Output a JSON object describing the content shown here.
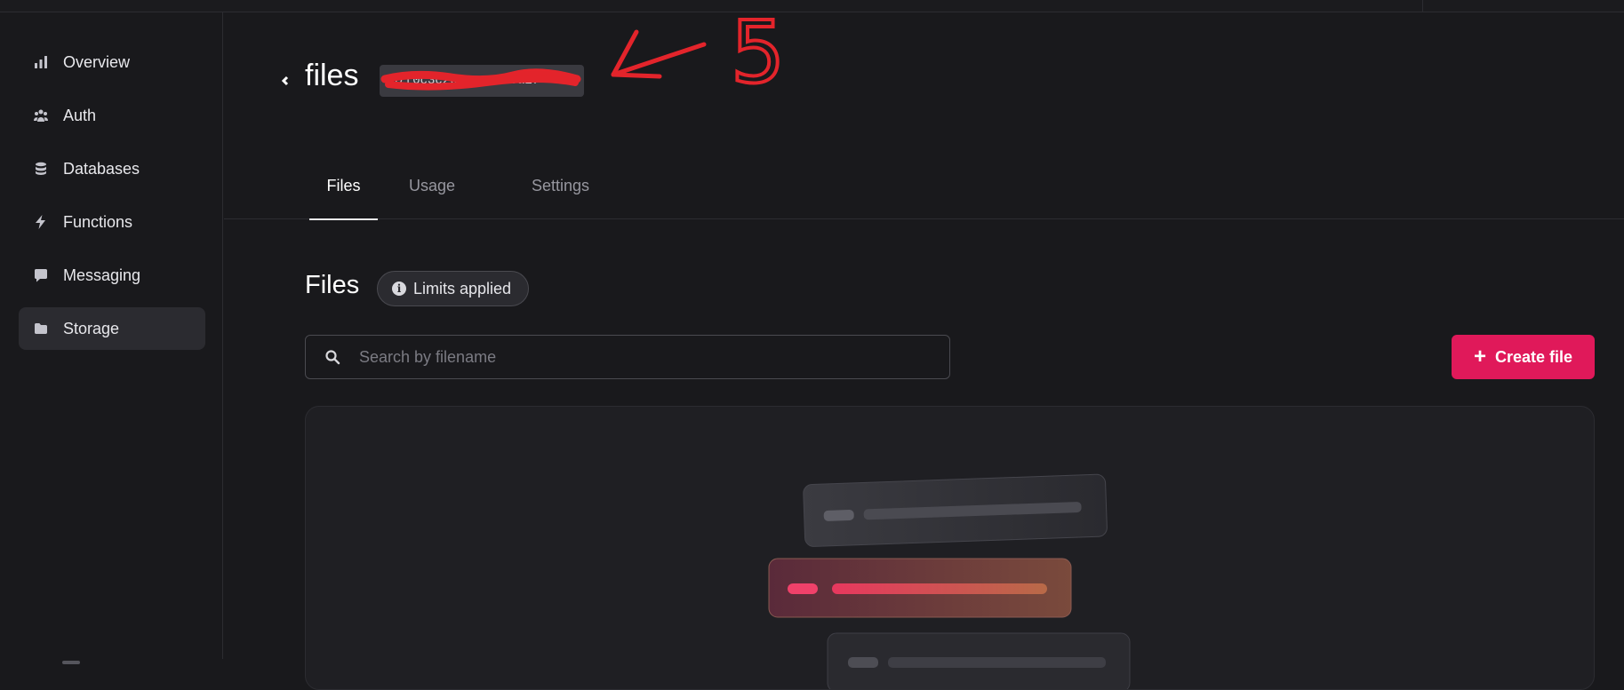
{
  "sidebar": {
    "items": [
      {
        "label": "Overview",
        "icon": "chart-bar-icon",
        "active": false
      },
      {
        "label": "Auth",
        "icon": "users-icon",
        "active": false
      },
      {
        "label": "Databases",
        "icon": "database-icon",
        "active": false
      },
      {
        "label": "Functions",
        "icon": "lightning-icon",
        "active": false
      },
      {
        "label": "Messaging",
        "icon": "chat-icon",
        "active": false
      },
      {
        "label": "Storage",
        "icon": "folder-icon",
        "active": true
      }
    ]
  },
  "header": {
    "title": "files",
    "bucket_id": "67f0c3c2001e3c2b5a1f"
  },
  "annotation": {
    "text": "5",
    "color": "#e3242b"
  },
  "tabs": [
    {
      "label": "Files",
      "active": true
    },
    {
      "label": "Usage",
      "active": false
    },
    {
      "label": "Settings",
      "active": false
    }
  ],
  "content": {
    "section_title": "Files",
    "limits_badge": "Limits applied",
    "search": {
      "placeholder": "Search by filename",
      "value": ""
    },
    "create_button": "Create file"
  },
  "colors": {
    "accent": "#e0195a",
    "background": "#19191c",
    "card": "#1f1f23"
  }
}
